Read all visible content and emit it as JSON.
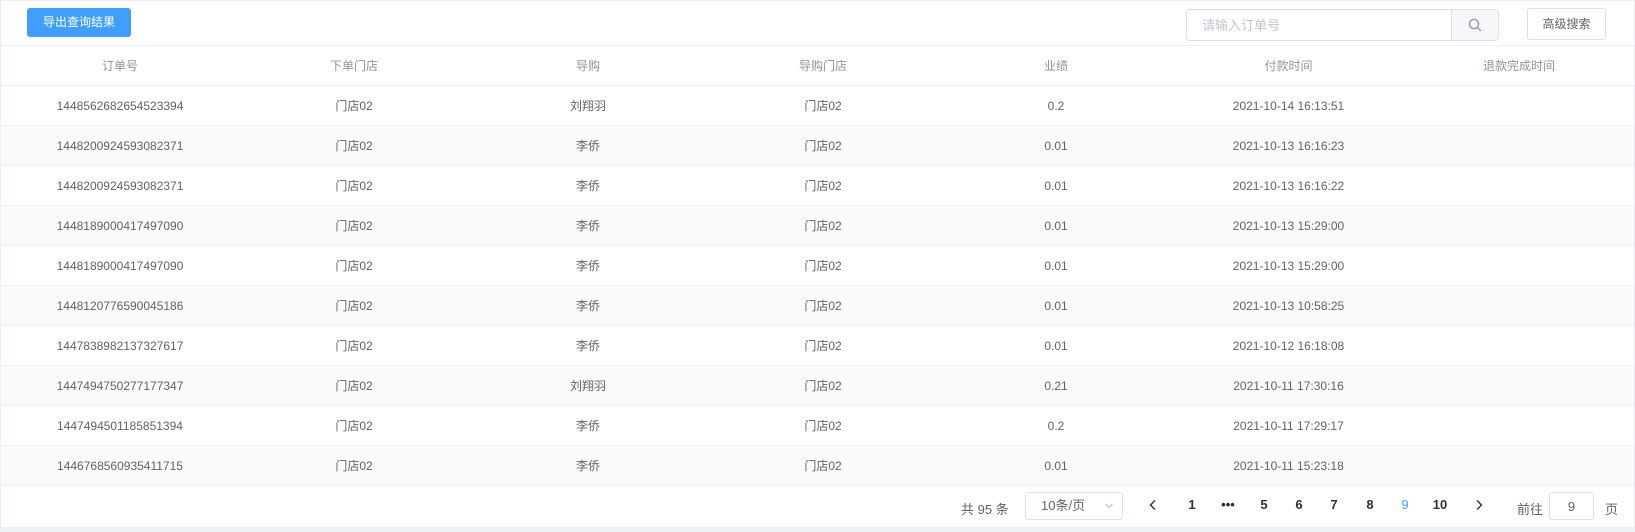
{
  "toolbar": {
    "export_label": "导出查询结果",
    "search_placeholder": "请输入订单号",
    "advanced_search_label": "高级搜索"
  },
  "table": {
    "columns": [
      "订单号",
      "下单门店",
      "导购",
      "导购门店",
      "业绩",
      "付款时间",
      "退款完成时间"
    ],
    "rows": [
      [
        "1448562682654523394",
        "门店02",
        "刘翔羽",
        "门店02",
        "0.2",
        "2021-10-14 16:13:51",
        ""
      ],
      [
        "1448200924593082371",
        "门店02",
        "李侨",
        "门店02",
        "0.01",
        "2021-10-13 16:16:23",
        ""
      ],
      [
        "1448200924593082371",
        "门店02",
        "李侨",
        "门店02",
        "0.01",
        "2021-10-13 16:16:22",
        ""
      ],
      [
        "1448189000417497090",
        "门店02",
        "李侨",
        "门店02",
        "0.01",
        "2021-10-13 15:29:00",
        ""
      ],
      [
        "1448189000417497090",
        "门店02",
        "李侨",
        "门店02",
        "0.01",
        "2021-10-13 15:29:00",
        ""
      ],
      [
        "1448120776590045186",
        "门店02",
        "李侨",
        "门店02",
        "0.01",
        "2021-10-13 10:58:25",
        ""
      ],
      [
        "1447838982137327617",
        "门店02",
        "李侨",
        "门店02",
        "0.01",
        "2021-10-12 16:18:08",
        ""
      ],
      [
        "1447494750277177347",
        "门店02",
        "刘翔羽",
        "门店02",
        "0.21",
        "2021-10-11 17:30:16",
        ""
      ],
      [
        "1447494501185851394",
        "门店02",
        "李侨",
        "门店02",
        "0.2",
        "2021-10-11 17:29:17",
        ""
      ],
      [
        "1446768560935411715",
        "门店02",
        "李侨",
        "门店02",
        "0.01",
        "2021-10-11 15:23:18",
        ""
      ]
    ]
  },
  "pagination": {
    "total_text": "共 95 条",
    "page_size": "10条/页",
    "pages": [
      "1",
      "•••",
      "5",
      "6",
      "7",
      "8",
      "9",
      "10"
    ],
    "current": "9",
    "goto_prefix": "前往",
    "goto_value": "9",
    "goto_suffix": "页"
  },
  "colors": {
    "primary": "#409eff",
    "border": "#ebeef5",
    "stripe": "#fafafa"
  }
}
